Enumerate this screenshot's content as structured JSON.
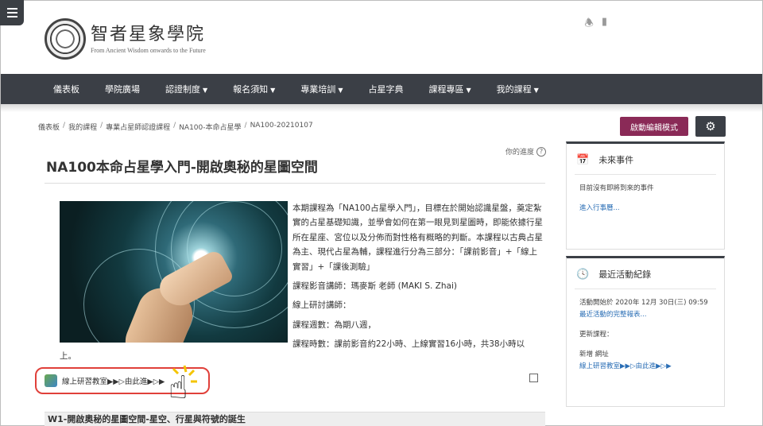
{
  "header": {
    "logo_title": "智者星象學院",
    "logo_subtitle": "From Ancient Wisdom onwards to the Future"
  },
  "nav": {
    "items": [
      {
        "label": "儀表板",
        "dropdown": false
      },
      {
        "label": "學院廣場",
        "dropdown": false
      },
      {
        "label": "認證制度",
        "dropdown": true
      },
      {
        "label": "報名須知",
        "dropdown": true
      },
      {
        "label": "專業培訓",
        "dropdown": true
      },
      {
        "label": "占星字典",
        "dropdown": false
      },
      {
        "label": "課程專區",
        "dropdown": true
      },
      {
        "label": "我的課程",
        "dropdown": true
      }
    ]
  },
  "breadcrumb": [
    "儀表板",
    "我的課程",
    "專業占星師認證課程",
    "NA100-本命占星學",
    "NA100-20210107"
  ],
  "toolbar": {
    "edit_mode_label": "啟動編輯模式"
  },
  "course": {
    "progress_label": "你的進度",
    "title": "NA100本命占星學入門-開啟奧秘的星圖空間",
    "description": [
      "本期課程為「NA100占星學入門」，目標在於開始認識星盤，奠定紮實的占星基礎知識，並學會如何在第一眼見到星圖時，即能依據行星所在星座、宮位以及分佈而對性格有概略的判斷。本課程以古典占星為主、現代占星為輔，課程進行分為三部分：「課前影音」+「線上實習」+「課後測驗」",
      "課程影音講師：瑪麥斯 老師 (MAKI S. Zhai)",
      "線上研討講師：",
      "課程週數：為期八週，",
      "課程時數：課前影音約22小時、上線實習16小時，共38小時以"
    ],
    "description_tail": "上。",
    "resource_label": "線上研習教室▶▶▷由此進▶▷▶",
    "section_title": "W1-開啟奧秘的星圖空間-星空、行星與符號的誕生"
  },
  "sidebar": {
    "events": {
      "title": "未來事件",
      "empty_text": "目前沒有即將到來的事件",
      "go_link": "進入行事曆..."
    },
    "activity": {
      "title": "最近活動紀錄",
      "since_text": "活動開始於 2020年 12月 30日(三) 09:59",
      "report_link": "最近活動的完整報表...",
      "updates_title": "更新課程：",
      "added_text": "新增 網址",
      "added_link": "線上研習教室▶▶▷由此進▶▷▶"
    }
  },
  "icons": {
    "menu": "hamburger-icon",
    "notifications": "bell-icon",
    "messages": "chat-bubble-icon",
    "settings": "gear-icon",
    "calendar": "calendar-icon",
    "clock": "clock-icon",
    "resource": "url-icon",
    "pointer": "hand-pointer-icon"
  },
  "colors": {
    "nav_bg": "#3b3f46",
    "edit_button": "#8a2a57",
    "highlight_ring": "#e0403a",
    "link": "#2a6eb5"
  }
}
